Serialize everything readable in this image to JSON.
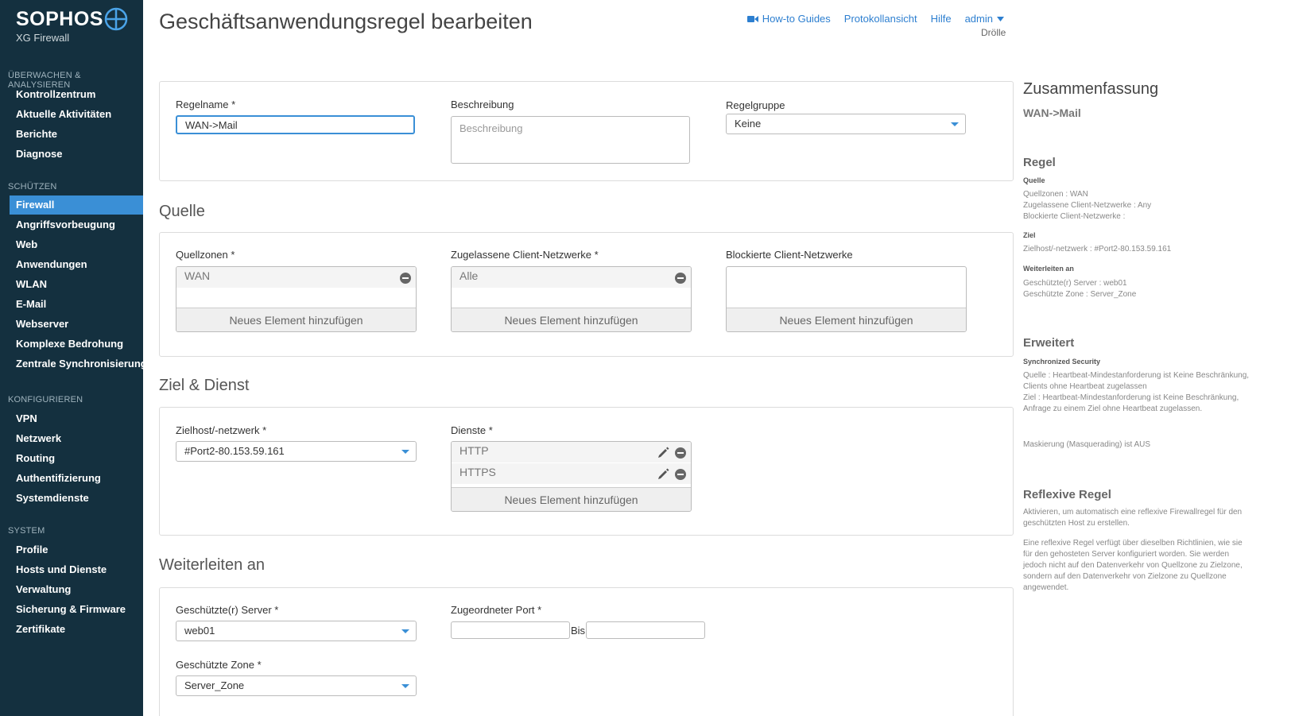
{
  "sidebar": {
    "brand": "SOPHOS",
    "product": "XG Firewall",
    "sections": [
      {
        "title": "ÜBERWACHEN & ANALYSIEREN",
        "items": [
          "Kontrollzentrum",
          "Aktuelle Aktivitäten",
          "Berichte",
          "Diagnose"
        ]
      },
      {
        "title": "SCHÜTZEN",
        "items": [
          "Firewall",
          "Angriffsvorbeugung",
          "Web",
          "Anwendungen",
          "WLAN",
          "E-Mail",
          "Webserver",
          "Komplexe Bedrohung",
          "Zentrale Synchronisierung"
        ]
      },
      {
        "title": "KONFIGURIEREN",
        "items": [
          "VPN",
          "Netzwerk",
          "Routing",
          "Authentifizierung",
          "Systemdienste"
        ]
      },
      {
        "title": "SYSTEM",
        "items": [
          "Profile",
          "Hosts und Dienste",
          "Verwaltung",
          "Sicherung & Firmware",
          "Zertifikate"
        ]
      }
    ],
    "active_item": "Firewall",
    "accent_color": "#3a8fd6",
    "bg_color": "#14303f"
  },
  "header": {
    "title": "Geschäftsanwendungsregel bearbeiten",
    "links": {
      "guides": "How-to Guides",
      "log": "Protokollansicht",
      "help": "Hilfe",
      "admin": "admin"
    },
    "subuser": "Drölle"
  },
  "rule": {
    "name_label": "Regelname *",
    "name_value": "WAN->Mail",
    "desc_label": "Beschreibung",
    "desc_placeholder": "Beschreibung",
    "group_label": "Regelgruppe",
    "group_value": "Keine"
  },
  "source": {
    "title": "Quelle",
    "zones_label": "Quellzonen *",
    "zones": [
      "WAN"
    ],
    "allowed_label": "Zugelassene Client-Netzwerke *",
    "allowed": [
      "Alle"
    ],
    "blocked_label": "Blockierte Client-Netzwerke",
    "add_label": "Neues Element hinzufügen"
  },
  "destination": {
    "title": "Ziel & Dienst",
    "host_label": "Zielhost/-netzwerk *",
    "host_value": "#Port2-80.153.59.161",
    "services_label": "Dienste *",
    "services": [
      "HTTP",
      "HTTPS"
    ],
    "add_label": "Neues Element hinzufügen"
  },
  "forward": {
    "title": "Weiterleiten an",
    "server_label": "Geschützte(r) Server *",
    "server_value": "web01",
    "port_label": "Zugeordneter Port *",
    "port_to_label": "Bis",
    "zone_label": "Geschützte Zone *",
    "zone_value": "Server_Zone"
  },
  "summary": {
    "title": "Zusammenfassung",
    "rule_name": "WAN->Mail",
    "rule_h": "Regel",
    "source_h": "Quelle",
    "source_lines": [
      "Quellzonen : WAN",
      "Zugelassene Client-Netzwerke : Any",
      "Blockierte Client-Netzwerke :"
    ],
    "dest_h": "Ziel",
    "dest_line": "Zielhost/-netzwerk : #Port2-80.153.59.161",
    "fwd_h": "Weiterleiten an",
    "fwd_lines": [
      "Geschützte(r) Server : web01",
      "Geschützte Zone : Server_Zone"
    ],
    "adv_h": "Erweitert",
    "sync_h": "Synchronized Security",
    "sync_text": "Quelle : Heartbeat-Mindestanforderung ist Keine Beschränkung, Clients ohne Heartbeat zugelassen\nZiel : Heartbeat-Mindestanforderung ist Keine Beschränkung, Anfrage zu einem Ziel ohne Heartbeat zugelassen.",
    "masq_text": "Maskierung (Masquerading) ist AUS",
    "reflex_h": "Reflexive Regel",
    "reflex_text1": "Aktivieren, um automatisch eine reflexive Firewallregel für den geschützten Host zu erstellen.",
    "reflex_text2": "Eine reflexive Regel verfügt über dieselben Richtlinien, wie sie für den gehosteten Server konfiguriert worden. Sie werden jedoch nicht auf den Datenverkehr von Quellzone zu Zielzone, sondern auf den Datenverkehr von Zielzone zu Quellzone angewendet."
  }
}
